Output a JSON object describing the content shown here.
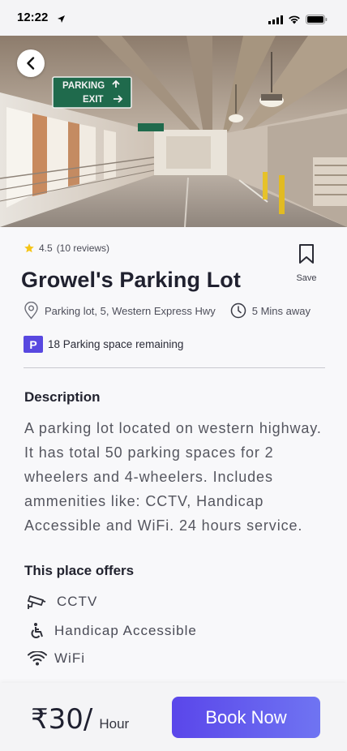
{
  "status_bar": {
    "time": "12:22"
  },
  "hero": {
    "sign_line1": "PARKING",
    "sign_line2": "EXIT"
  },
  "listing": {
    "rating": "4.5",
    "reviews": "(10 reviews)",
    "name": "Growel's Parking Lot",
    "save_label": "Save",
    "address": "Parking lot, 5, Western Express Hwy",
    "distance": "5 Mins away",
    "parking_badge": "P",
    "spaces_remaining": "18 Parking space remaining"
  },
  "description": {
    "title": "Description",
    "text": "A parking lot located on western highway. It has total 50 parking spaces for 2 wheelers and 4-wheelers. Includes ammenities like: CCTV, Handicap Accessible and WiFi. 24 hours service."
  },
  "offers": {
    "title": "This place offers",
    "items": [
      {
        "label": "CCTV",
        "icon": "cctv-icon"
      },
      {
        "label": "Handicap Accessible",
        "icon": "wheelchair-icon"
      },
      {
        "label": "WiFi",
        "icon": "wifi-icon"
      }
    ]
  },
  "booking": {
    "price": "₹30/",
    "unit": "Hour",
    "button_label": "Book Now"
  },
  "colors": {
    "accent": "#5848e0",
    "button_gradient_start": "#5a46ea",
    "button_gradient_end": "#6f74f2",
    "star": "#f5c518",
    "sign_green": "#1f6a4c"
  }
}
